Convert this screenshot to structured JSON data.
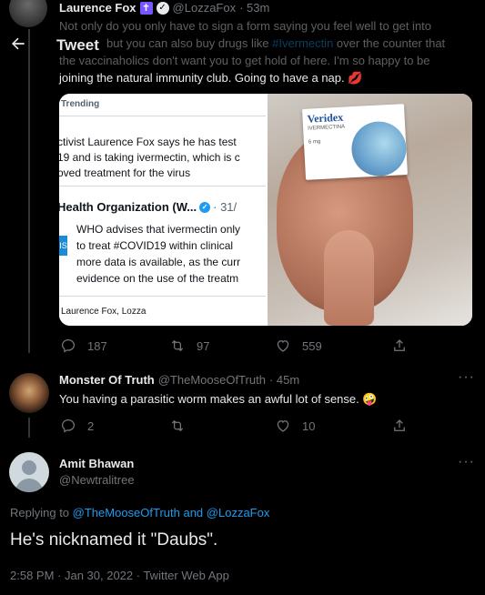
{
  "header": {
    "title": "Tweet"
  },
  "tweet1": {
    "name": "Laurence Fox",
    "handle": "@LozzaFox",
    "time": "· 53m",
    "text_a": "Not only do you only have to sign a form saying you feel well to get into",
    "text_b1": "but you can also buy drugs like ",
    "hashtag": "#Ivermectin",
    "text_b2": " over the counter that",
    "text_c": "the vaccinaholics don't want you to get hold of here. I'm so happy to be",
    "text_d": "joining the natural immunity club. Going to have a nap. 💋",
    "card": {
      "trending": "Trending",
      "line1": "ctivist Laurence Fox says he has test",
      "line2": "19 and is taking ivermectin, which is c",
      "line3": "oved treatment for the virus",
      "org": "Health Organization (W...",
      "org_date": "· 31/",
      "who1": "WHO advises that ivermectin only",
      "who2": "to treat #COVID19 within clinical",
      "who3": "more data is available, as the curr",
      "who4": "evidence on the use of the treatm",
      "credit": "Laurence Fox, Lozza",
      "box_brand": "Veridex",
      "box_sub": "IVERMECTINA",
      "box_dose": "6 mg"
    },
    "replies": "187",
    "retweets": "97",
    "likes": "559"
  },
  "tweet2": {
    "name": "Monster Of Truth",
    "handle": "@TheMooseOfTruth",
    "time": "· 45m",
    "text": "You having a parasitic worm makes an awful lot of sense. 🤪",
    "replies": "2",
    "likes": "10"
  },
  "main": {
    "name": "Amit Bhawan",
    "handle": "@Newtralitree",
    "replying_prefix": "Replying to ",
    "reply_handle1": "@TheMooseOfTruth",
    "reply_and": " and ",
    "reply_handle2": "@LozzaFox",
    "text": "He's nicknamed it \"Daubs\".",
    "timestamp": "2:58 PM · Jan 30, 2022 · Twitter Web App"
  },
  "colors": {
    "accent": "#1d9bf0",
    "muted": "#71767b",
    "text": "#e7e9ea",
    "bg": "#000000"
  }
}
